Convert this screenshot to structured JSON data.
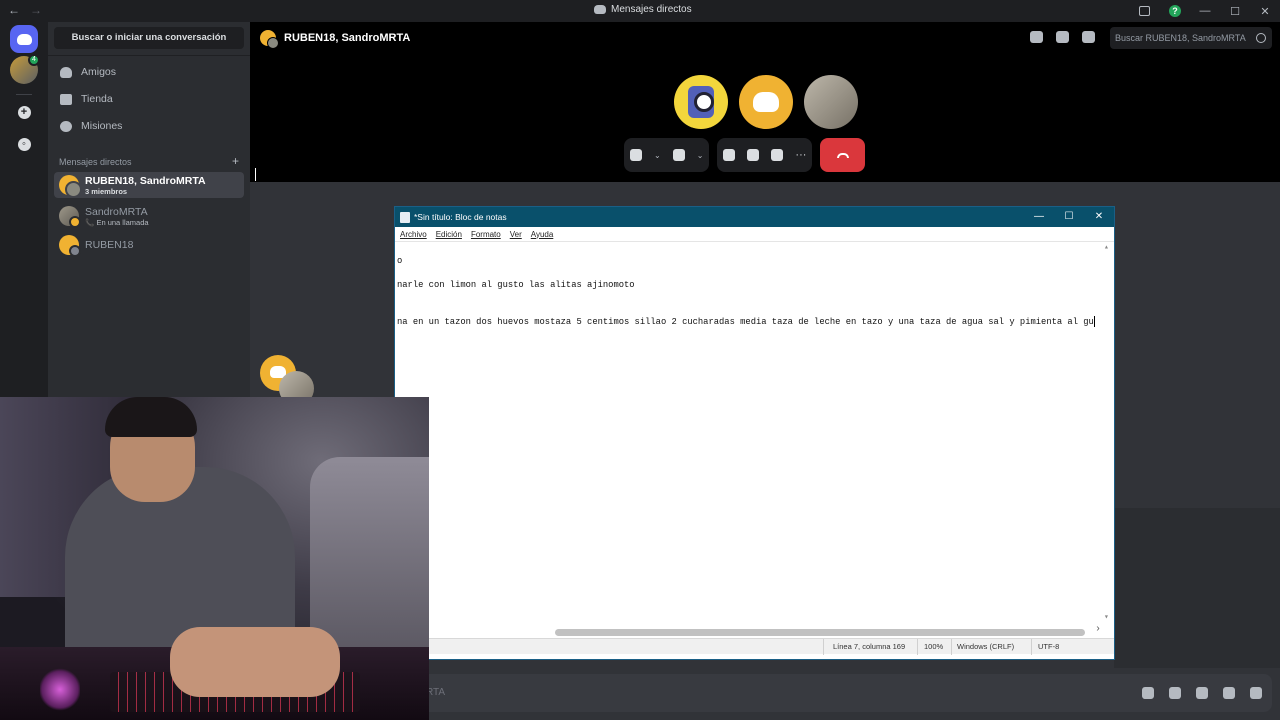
{
  "window": {
    "title": "Mensajes directos",
    "nav_back": "←",
    "nav_forward": "→",
    "min": "—",
    "max": "☐",
    "close": "✕",
    "help": "?"
  },
  "sidebar": {
    "search_label": "Buscar o iniciar una conversación",
    "nav": [
      {
        "label": "Amigos",
        "icon": "friends-icon"
      },
      {
        "label": "Tienda",
        "icon": "shop-icon"
      },
      {
        "label": "Misiones",
        "icon": "quests-icon"
      }
    ],
    "dm_header": "Mensajes directos",
    "dm_add": "+",
    "dms": [
      {
        "name": "RUBEN18, SandroMRTA",
        "sub": "3 miembros",
        "active": true
      },
      {
        "name": "SandroMRTA",
        "sub_icon": "📞",
        "sub": "En una llamada",
        "active": false
      },
      {
        "name": "RUBEN18",
        "sub": "",
        "active": false
      }
    ],
    "guild_badge": "4"
  },
  "call": {
    "title": "RUBEN18, SandroMRTA",
    "search_placeholder": "Buscar RUBEN18, SandroMRTA",
    "controls": {
      "more": "···",
      "chevron": "⌄"
    }
  },
  "chat": {
    "input_hint": "RTA"
  },
  "notepad": {
    "title": "*Sin título: Bloc de notas",
    "menu": [
      "Archivo",
      "Edición",
      "Formato",
      "Ver",
      "Ayuda"
    ],
    "lines": [
      "o",
      "narle con limon al gusto las alitas ajinomoto",
      "na en un tazon dos huevos mostaza 5 centimos sillao 2 cucharadas media taza de leche en tazo y una taza de agua sal y pimienta al gu"
    ],
    "status": {
      "position": "Línea 7, columna 169",
      "zoom": "100%",
      "eol": "Windows (CRLF)",
      "encoding": "UTF-8"
    },
    "buttons": {
      "min": "—",
      "max": "☐",
      "close": "✕"
    }
  },
  "colors": {
    "discord_blurple": "#5865f2",
    "hangup_red": "#da373c",
    "online_green": "#23a55a",
    "notepad_titlebar": "#09506b"
  }
}
